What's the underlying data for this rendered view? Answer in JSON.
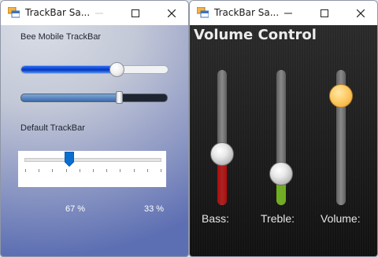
{
  "windows": [
    {
      "title": "TrackBar Sa...",
      "bee_label": "Bee Mobile TrackBar",
      "default_label": "Default TrackBar",
      "slider1_value": 0.67,
      "slider2_value": 0.67,
      "std_value": 0.33,
      "left_percent": "67 %",
      "right_percent": "33 %"
    },
    {
      "title": "TrackBar Sa...",
      "heading": "Volume Control",
      "sliders": [
        {
          "label": "Bass:",
          "value": 0.38,
          "fill_color": "#b20d0d",
          "knob": "metal"
        },
        {
          "label": "Treble:",
          "value": 0.23,
          "fill_color": "#6fb316",
          "knob": "metal"
        },
        {
          "label": "Volume:",
          "value": 0.81,
          "fill_color": "",
          "knob": "gold"
        }
      ]
    }
  ],
  "icons": {
    "app": "app-window-icon",
    "minimize": "minimize-icon",
    "maximize": "maximize-icon",
    "close": "close-icon"
  }
}
